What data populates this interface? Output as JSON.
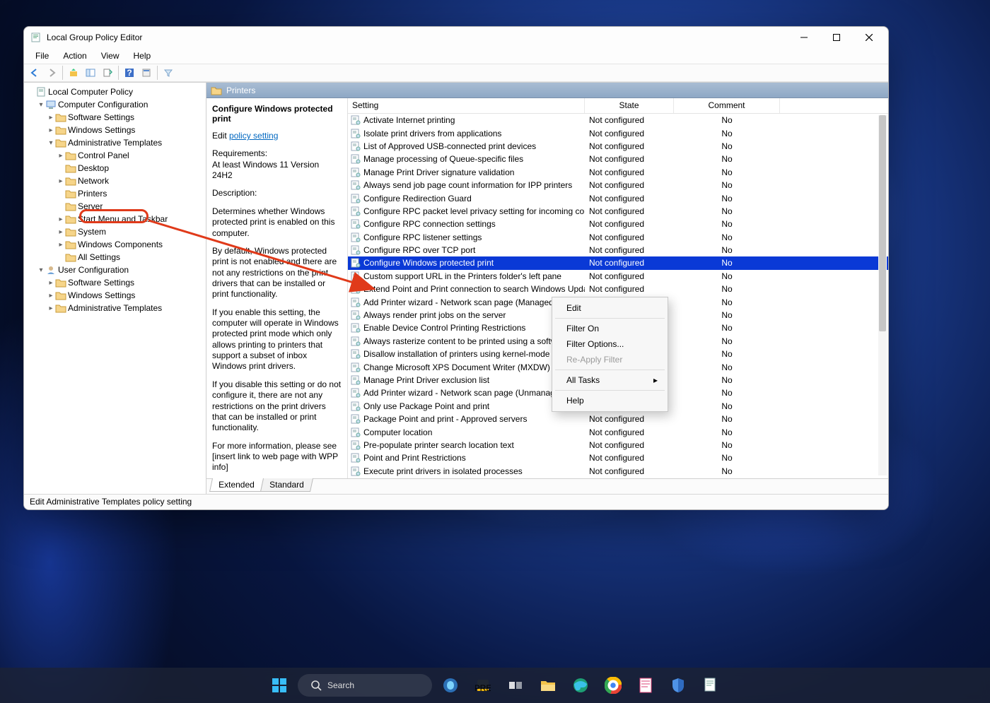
{
  "window": {
    "title": "Local Group Policy Editor"
  },
  "menu": [
    "File",
    "Action",
    "View",
    "Help"
  ],
  "tree": {
    "root": "Local Computer Policy",
    "computer_cfg": "Computer Configuration",
    "user_cfg": "User Configuration",
    "cc": [
      "Software Settings",
      "Windows Settings",
      "Administrative Templates"
    ],
    "adm": [
      "Control Panel",
      "Desktop",
      "Network",
      "Printers",
      "Server",
      "Start Menu and Taskbar",
      "System",
      "Windows Components",
      "All Settings"
    ],
    "uc": [
      "Software Settings",
      "Windows Settings",
      "Administrative Templates"
    ]
  },
  "content": {
    "header": "Printers",
    "policy_title": "Configure Windows protected print",
    "edit_prefix": "Edit ",
    "edit_link": "policy setting",
    "req_label": "Requirements:",
    "req_text": "At least Windows 11 Version 24H2",
    "desc_label": "Description:",
    "p1": "Determines whether Windows protected print is enabled on this computer.",
    "p2": "By default, Windows protected print is not enabled and there are not any restrictions on the print drivers that can be installed or print functionality.",
    "p3": "If you enable this setting, the computer will operate in Windows protected print mode which only allows printing to printers that support a subset of inbox Windows print drivers.",
    "p4": "If you disable this setting or do not configure it, there are not any restrictions on the print drivers that can be installed or print functionality.",
    "p5": "For more information, please see [insert link to web page with WPP info]"
  },
  "columns": {
    "setting": "Setting",
    "state": "State",
    "comment": "Comment"
  },
  "default_state": "Not configured",
  "default_comment": "No",
  "settings": [
    "Activate Internet printing",
    "Isolate print drivers from applications",
    "List of Approved USB-connected print devices",
    "Manage processing of Queue-specific files",
    "Manage Print Driver signature validation",
    "Always send job page count information for IPP printers",
    "Configure Redirection Guard",
    "Configure RPC packet level privacy setting for incoming conn...",
    "Configure RPC connection settings",
    "Configure RPC listener settings",
    "Configure RPC over TCP port",
    "Configure Windows protected print",
    "Custom support URL in the Printers folder's left pane",
    "Extend Point and Print connection to search Windows Update",
    "Add Printer wizard - Network scan page (Managed network)",
    "Always render print jobs on the server",
    "Enable Device Control Printing Restrictions",
    "Always rasterize content to be printed using a software rasterizer",
    "Disallow installation of printers using kernel-mode drivers",
    "Change Microsoft XPS Document Writer (MXDW) default output",
    "Manage Print Driver exclusion list",
    "Add Printer wizard - Network scan page (Unmanaged network)",
    "Only use Package Point and print",
    "Package Point and print - Approved servers",
    "Computer location",
    "Pre-populate printer search location text",
    "Point and Print Restrictions",
    "Execute print drivers in isolated processes"
  ],
  "selected_index": 11,
  "context_menu": {
    "items": [
      "Edit",
      "Filter On",
      "Filter Options...",
      "Re-Apply Filter",
      "All Tasks",
      "Help"
    ],
    "disabled": [
      "Re-Apply Filter"
    ],
    "submenu": [
      "All Tasks"
    ],
    "highlight_index": 0
  },
  "tabs": [
    "Extended",
    "Standard"
  ],
  "statusbar": "Edit Administrative Templates policy setting",
  "taskbar": {
    "search": "Search"
  }
}
